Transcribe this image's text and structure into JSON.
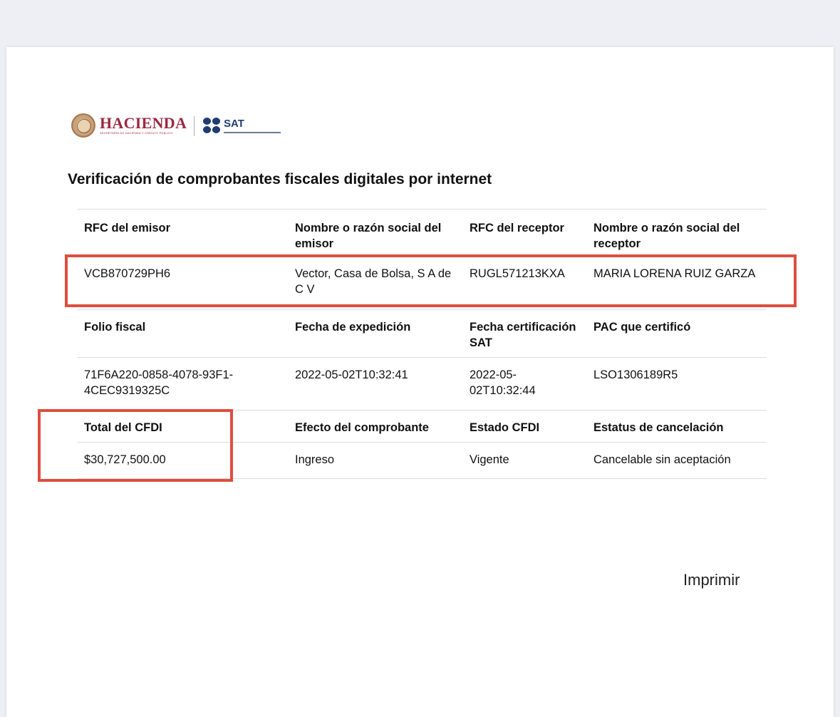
{
  "logos": {
    "hacienda_title": "HACIENDA",
    "hacienda_subtitle": "SECRETARÍA DE HACIENDA Y CRÉDITO PÚBLICO",
    "sat_title": "SAT",
    "seal_icon": "mexican-seal-icon",
    "sat_icon": "sat-dots-icon",
    "colors": {
      "hacienda": "#9b2742",
      "sat": "#1f3b73"
    }
  },
  "title": "Verificación de comprobantes fiscales digitales por internet",
  "table": {
    "sections": [
      {
        "headers": [
          "RFC del emisor",
          "Nombre o razón social del emisor",
          "RFC del receptor",
          "Nombre o razón social del receptor"
        ],
        "values": [
          "VCB870729PH6",
          "Vector, Casa de Bolsa, S A de C V",
          "RUGL571213KXA",
          "MARIA LORENA RUIZ GARZA"
        ]
      },
      {
        "headers": [
          "Folio fiscal",
          "Fecha de expedición",
          "Fecha certificación SAT",
          "PAC que certificó"
        ],
        "values": [
          "71F6A220-0858-4078-93F1-4CEC9319325C",
          "2022-05-02T10:32:41",
          "2022-05-02T10:32:44",
          "LSO1306189R5"
        ]
      },
      {
        "headers": [
          "Total del CFDI",
          "Efecto del comprobante",
          "Estado CFDI",
          "Estatus de cancelación"
        ],
        "values": [
          "$30,727,500.00",
          "Ingreso",
          "Vigente",
          "Cancelable sin aceptación"
        ]
      }
    ]
  },
  "print_label": "Imprimir",
  "highlight_color": "#de4e3e"
}
